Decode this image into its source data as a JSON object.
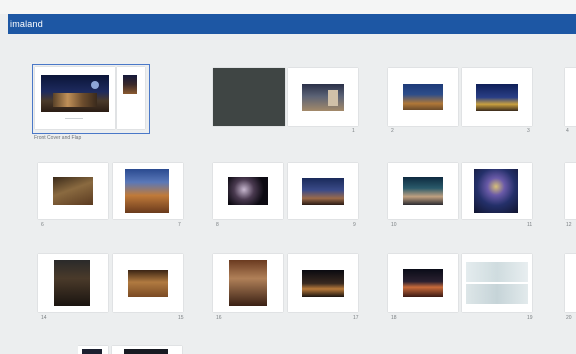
{
  "header": {
    "title": "imaland"
  },
  "spreads": {
    "cover": {
      "label": "Front Cover and Flap"
    },
    "s1": {
      "right_page_number": "1"
    },
    "s2": {
      "left_page_number": "2",
      "right_page_number": "3"
    },
    "s3": {
      "left_page_number": "4"
    },
    "s4": {
      "left_page_number": "6",
      "right_page_number": "7"
    },
    "s5": {
      "left_page_number": "8",
      "right_page_number": "9"
    },
    "s6": {
      "left_page_number": "10",
      "right_page_number": "11"
    },
    "s7": {
      "left_page_number": "12"
    },
    "s8": {
      "left_page_number": "14",
      "right_page_number": "15"
    },
    "s9": {
      "left_page_number": "16",
      "right_page_number": "17"
    },
    "s10": {
      "left_page_number": "18",
      "right_page_number": "19"
    },
    "s11": {
      "left_page_number": "20"
    }
  },
  "colors": {
    "header_blue": "#1d57a4",
    "selection_blue": "#4a78c8",
    "background": "#eceeef"
  }
}
